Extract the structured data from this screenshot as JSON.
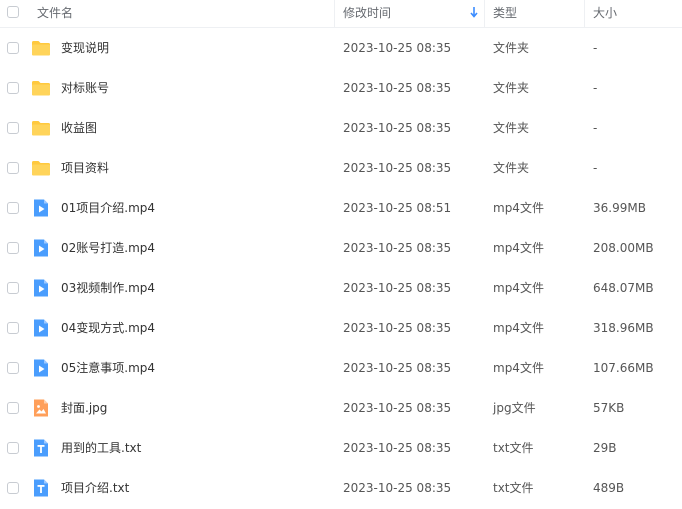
{
  "header": {
    "name_label": "文件名",
    "time_label": "修改时间",
    "type_label": "类型",
    "size_label": "大小",
    "sort_icon": "arrow-down-icon",
    "sort_color": "#3b8cff"
  },
  "colors": {
    "folder": "#ffc93e",
    "video": "#4a9dfd",
    "image": "#ff9f5a",
    "text": "#4a9dfd"
  },
  "files": [
    {
      "name": "变现说明",
      "time": "2023-10-25 08:35",
      "type": "文件夹",
      "size": "-",
      "icon": "folder-icon"
    },
    {
      "name": "对标账号",
      "time": "2023-10-25 08:35",
      "type": "文件夹",
      "size": "-",
      "icon": "folder-icon"
    },
    {
      "name": "收益图",
      "time": "2023-10-25 08:35",
      "type": "文件夹",
      "size": "-",
      "icon": "folder-icon"
    },
    {
      "name": "项目资料",
      "time": "2023-10-25 08:35",
      "type": "文件夹",
      "size": "-",
      "icon": "folder-icon"
    },
    {
      "name": "01项目介绍.mp4",
      "time": "2023-10-25 08:51",
      "type": "mp4文件",
      "size": "36.99MB",
      "icon": "video-icon"
    },
    {
      "name": "02账号打造.mp4",
      "time": "2023-10-25 08:35",
      "type": "mp4文件",
      "size": "208.00MB",
      "icon": "video-icon"
    },
    {
      "name": "03视频制作.mp4",
      "time": "2023-10-25 08:35",
      "type": "mp4文件",
      "size": "648.07MB",
      "icon": "video-icon"
    },
    {
      "name": "04变现方式.mp4",
      "time": "2023-10-25 08:35",
      "type": "mp4文件",
      "size": "318.96MB",
      "icon": "video-icon"
    },
    {
      "name": "05注意事项.mp4",
      "time": "2023-10-25 08:35",
      "type": "mp4文件",
      "size": "107.66MB",
      "icon": "video-icon"
    },
    {
      "name": "封面.jpg",
      "time": "2023-10-25 08:35",
      "type": "jpg文件",
      "size": "57KB",
      "icon": "image-icon"
    },
    {
      "name": "用到的工具.txt",
      "time": "2023-10-25 08:35",
      "type": "txt文件",
      "size": "29B",
      "icon": "text-file-icon"
    },
    {
      "name": "项目介绍.txt",
      "time": "2023-10-25 08:35",
      "type": "txt文件",
      "size": "489B",
      "icon": "text-file-icon"
    }
  ]
}
